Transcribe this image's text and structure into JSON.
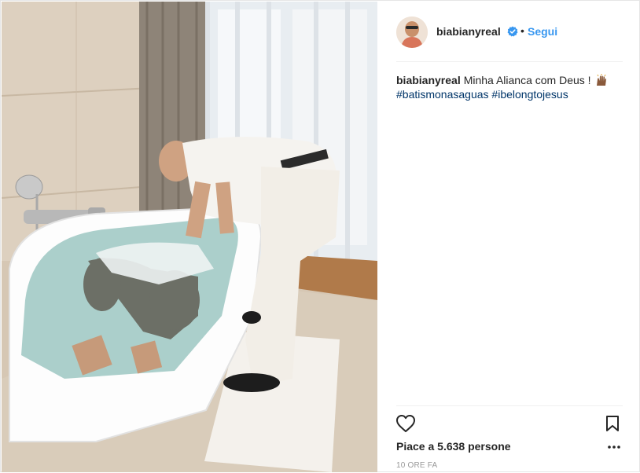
{
  "post": {
    "photo": {
      "alt_icon": "photo-image",
      "bg_color": "#cdbfae"
    },
    "header": {
      "username": "biabianyreal",
      "verified_icon": "verified-badge-icon",
      "separator": "•",
      "follow_label": "Segui"
    },
    "caption": {
      "username": "biabianyreal",
      "text": "Minha Alianca com Deus !",
      "emoji_icon": "raised-hands-emoji-icon",
      "hashtags": [
        "#batismonasaguas",
        "#ibelongtojesus"
      ]
    },
    "actions": {
      "like_icon": "heart-icon",
      "save_icon": "bookmark-icon",
      "more_icon": "more-dots-icon"
    },
    "likes_text": "Piace a 5.638 persone",
    "time_text": "10 ORE FA",
    "colors": {
      "link_blue": "#3897f0",
      "hashtag_blue": "#003569",
      "text": "#262626",
      "muted": "#999999"
    }
  }
}
